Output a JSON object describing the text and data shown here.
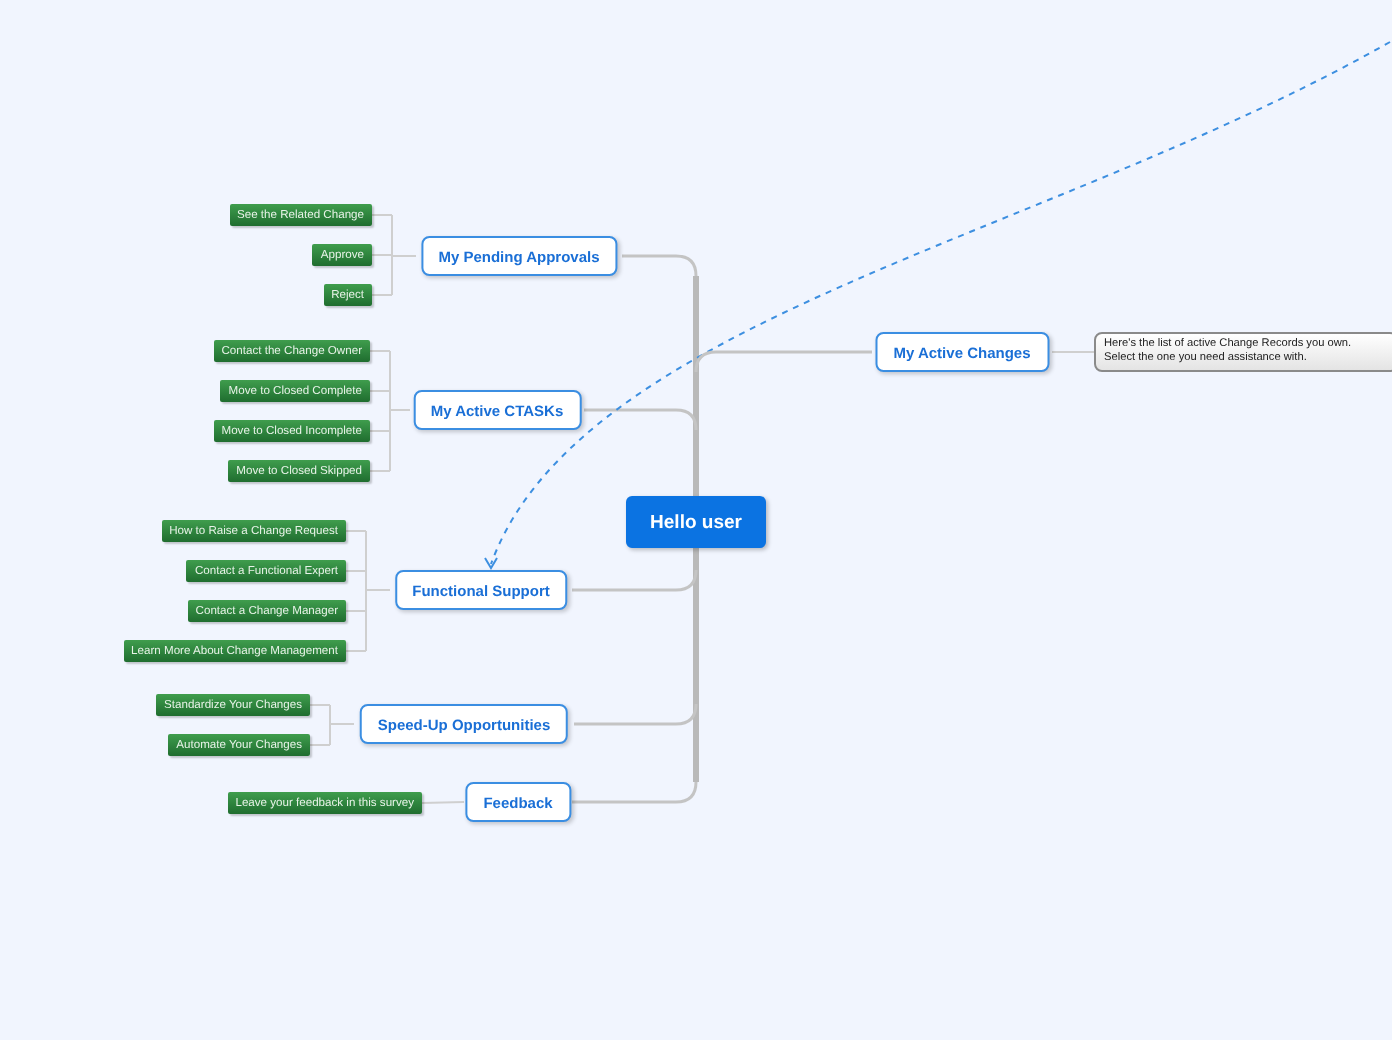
{
  "root": {
    "label": "Hello user"
  },
  "branches": [
    {
      "label": "My Pending Approvals",
      "children": [
        {
          "label": "See the Related Change"
        },
        {
          "label": "Approve"
        },
        {
          "label": "Reject"
        }
      ]
    },
    {
      "label": "My Active CTASKs",
      "children": [
        {
          "label": "Contact the Change Owner"
        },
        {
          "label": "Move to Closed Complete"
        },
        {
          "label": "Move to Closed Incomplete"
        },
        {
          "label": "Move to Closed Skipped"
        }
      ]
    },
    {
      "label": "Functional Support",
      "linked": true,
      "children": [
        {
          "label": "How to Raise a Change Request"
        },
        {
          "label": "Contact a Functional Expert"
        },
        {
          "label": "Contact a Change Manager"
        },
        {
          "label": "Learn More About Change Management"
        }
      ]
    },
    {
      "label": "Speed-Up Opportunities",
      "children": [
        {
          "label": "Standardize Your Changes"
        },
        {
          "label": "Automate Your Changes"
        }
      ]
    },
    {
      "label": "Feedback",
      "children": [
        {
          "label": "Leave your feedback in this survey"
        }
      ]
    },
    {
      "label": "My Active Changes",
      "note": "Here's the list of active Change Records you own.\nSelect the one you need assistance with."
    }
  ]
}
